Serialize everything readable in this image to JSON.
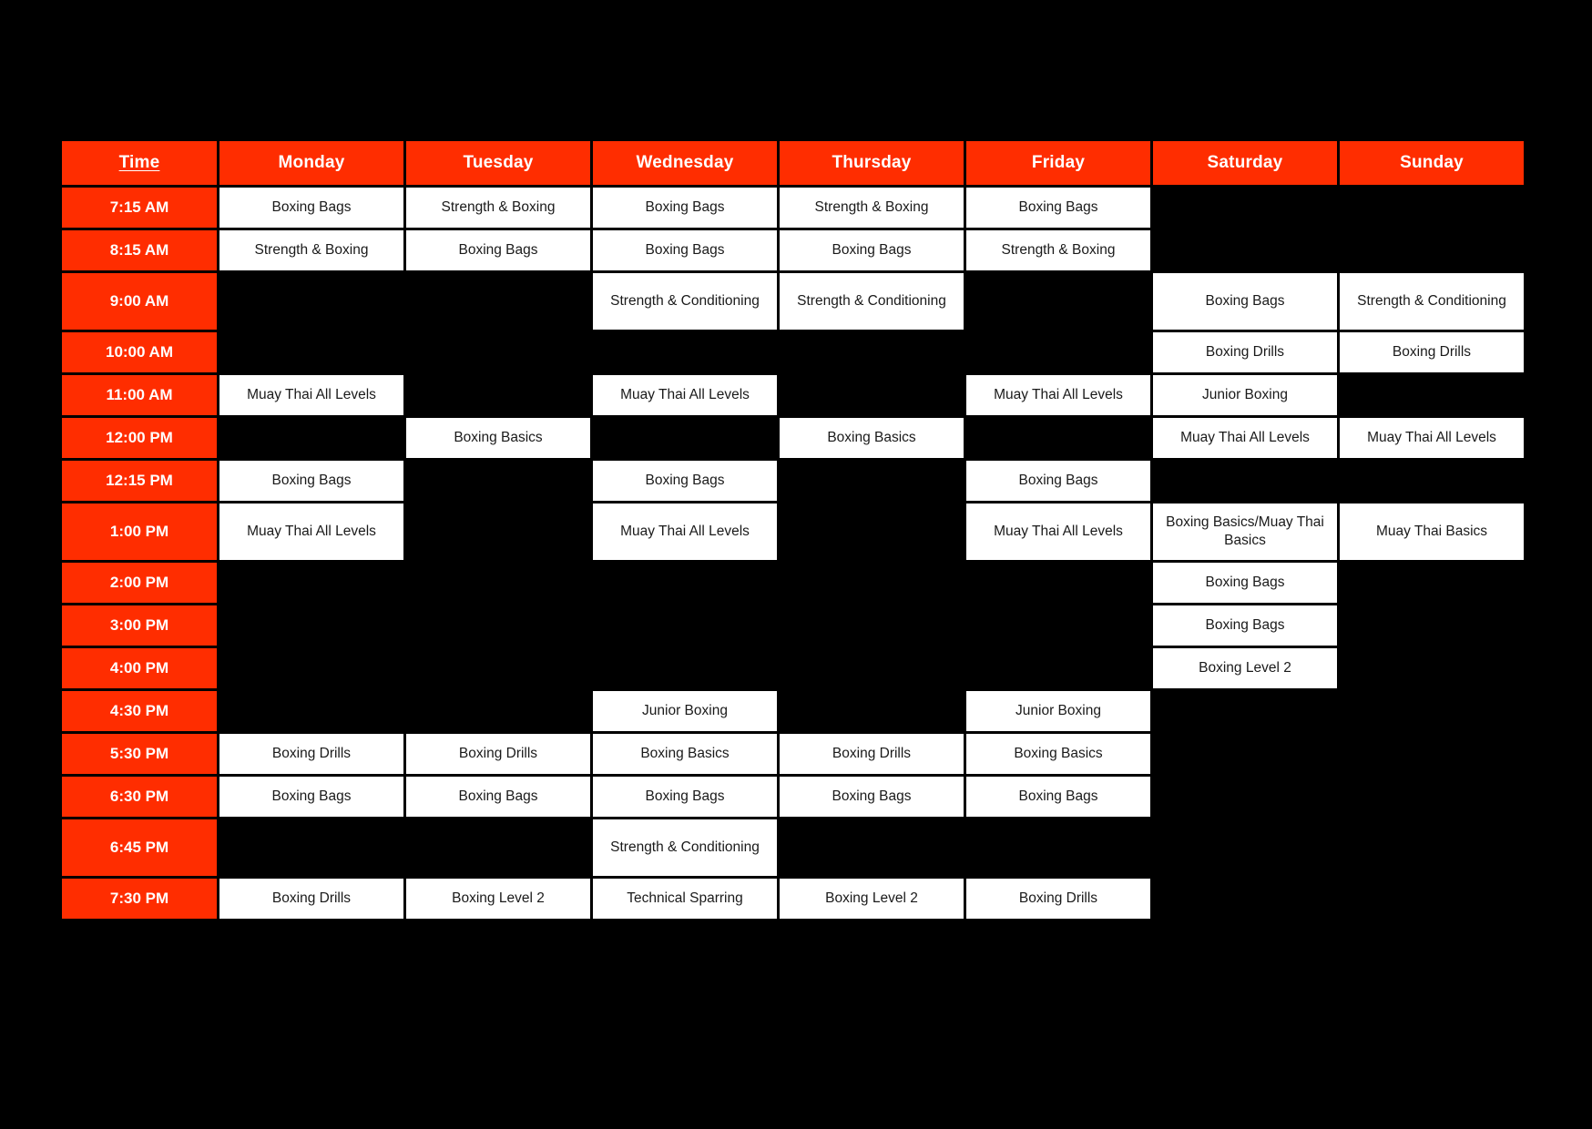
{
  "page": {
    "background_color": "#000000",
    "accent_color": "#FF2D00",
    "cell_color": "#FFFFFF",
    "header_text_color": "#FFFFFF"
  },
  "schedule": {
    "columns": [
      {
        "key": "time",
        "label": "Time",
        "underlined": true
      },
      {
        "key": "monday",
        "label": "Monday"
      },
      {
        "key": "tuesday",
        "label": "Tuesday"
      },
      {
        "key": "wednesday",
        "label": "Wednesday"
      },
      {
        "key": "thursday",
        "label": "Thursday"
      },
      {
        "key": "friday",
        "label": "Friday"
      },
      {
        "key": "saturday",
        "label": "Saturday"
      },
      {
        "key": "sunday",
        "label": "Sunday"
      }
    ],
    "rows": [
      {
        "time": "7:15 AM",
        "tall": false,
        "cells": [
          "Boxing Bags",
          "Strength & Boxing",
          "Boxing Bags",
          "Strength & Boxing",
          "Boxing Bags",
          "",
          ""
        ]
      },
      {
        "time": "8:15 AM",
        "tall": false,
        "cells": [
          "Strength & Boxing",
          "Boxing Bags",
          "Boxing Bags",
          "Boxing Bags",
          "Strength & Boxing",
          "",
          ""
        ]
      },
      {
        "time": "9:00 AM",
        "tall": true,
        "cells": [
          "",
          "",
          "Strength & Conditioning",
          "Strength & Conditioning",
          "",
          "Boxing Bags",
          "Strength & Conditioning"
        ]
      },
      {
        "time": "10:00 AM",
        "tall": false,
        "cells": [
          "",
          "",
          "",
          "",
          "",
          "Boxing Drills",
          "Boxing Drills"
        ]
      },
      {
        "time": "11:00 AM",
        "tall": false,
        "cells": [
          "Muay Thai All Levels",
          "",
          "Muay Thai All Levels",
          "",
          "Muay Thai All Levels",
          "Junior Boxing",
          ""
        ]
      },
      {
        "time": "12:00 PM",
        "tall": false,
        "cells": [
          "",
          "Boxing Basics",
          "",
          "Boxing Basics",
          "",
          "Muay Thai All Levels",
          "Muay Thai All Levels"
        ]
      },
      {
        "time": "12:15 PM",
        "tall": false,
        "cells": [
          "Boxing Bags",
          "",
          "Boxing Bags",
          "",
          "Boxing Bags",
          "",
          ""
        ]
      },
      {
        "time": "1:00 PM",
        "tall": true,
        "cells": [
          "Muay Thai All Levels",
          "",
          "Muay Thai All Levels",
          "",
          "Muay Thai All Levels",
          "Boxing Basics/Muay Thai Basics",
          "Muay Thai Basics"
        ]
      },
      {
        "time": "2:00 PM",
        "tall": false,
        "cells": [
          "",
          "",
          "",
          "",
          "",
          "Boxing Bags",
          ""
        ]
      },
      {
        "time": "3:00 PM",
        "tall": false,
        "cells": [
          "",
          "",
          "",
          "",
          "",
          "Boxing Bags",
          ""
        ]
      },
      {
        "time": "4:00 PM",
        "tall": false,
        "cells": [
          "",
          "",
          "",
          "",
          "",
          "Boxing Level 2",
          ""
        ]
      },
      {
        "time": "4:30 PM",
        "tall": false,
        "cells": [
          "",
          "",
          "Junior Boxing",
          "",
          "Junior Boxing",
          "",
          ""
        ]
      },
      {
        "time": "5:30 PM",
        "tall": false,
        "cells": [
          "Boxing Drills",
          "Boxing Drills",
          "Boxing Basics",
          "Boxing Drills",
          "Boxing Basics",
          "",
          ""
        ]
      },
      {
        "time": "6:30 PM",
        "tall": false,
        "cells": [
          "Boxing Bags",
          "Boxing Bags",
          "Boxing Bags",
          "Boxing Bags",
          "Boxing Bags",
          "",
          ""
        ]
      },
      {
        "time": "6:45 PM",
        "tall": true,
        "cells": [
          "",
          "",
          "Strength & Conditioning",
          "",
          "",
          "",
          ""
        ]
      },
      {
        "time": "7:30 PM",
        "tall": false,
        "cells": [
          "Boxing Drills",
          "Boxing Level 2",
          "Technical Sparring",
          "Boxing Level 2",
          "Boxing Drills",
          "",
          ""
        ]
      }
    ]
  }
}
